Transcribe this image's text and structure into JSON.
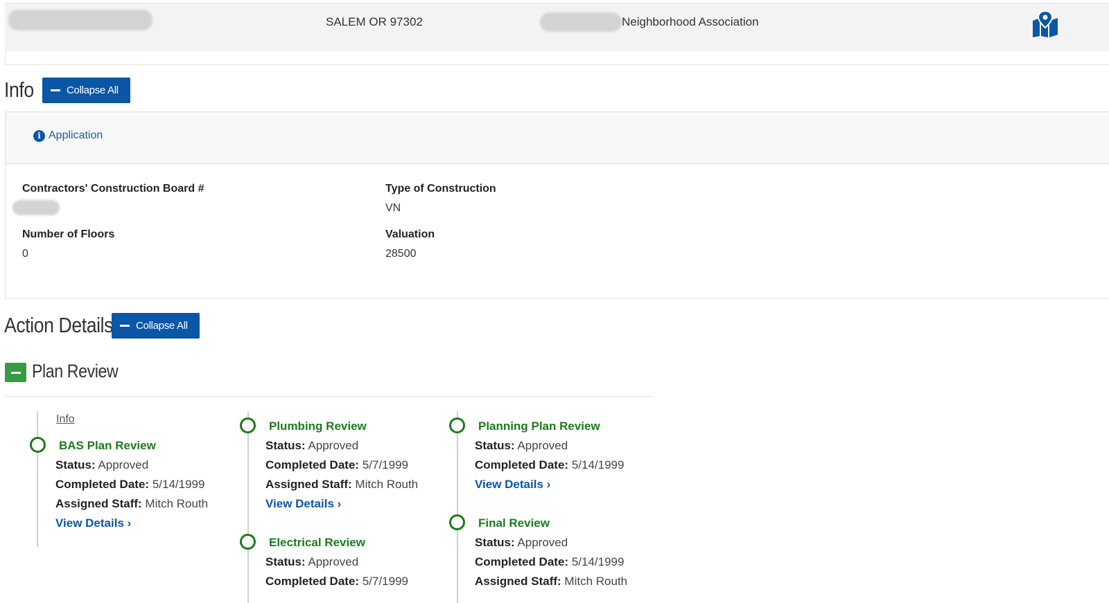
{
  "address_bar": {
    "city_state_zip": "SALEM OR 97302",
    "neighborhood_suffix": "Neighborhood Association"
  },
  "info_section": {
    "title": "Info",
    "collapse_label": "Collapse All",
    "tab_label": "Application",
    "fields": {
      "ccb_label": "Contractors' Construction Board #",
      "construction_type_label": "Type of Construction",
      "construction_type_value": "VN",
      "floors_label": "Number of Floors",
      "floors_value": "0",
      "valuation_label": "Valuation",
      "valuation_value": "28500"
    }
  },
  "action_details": {
    "title": "Action Details",
    "collapse_label": "Collapse All",
    "group_title": "Plan Review",
    "info_link": "Info",
    "status_label": "Status:",
    "completed_label": "Completed Date:",
    "staff_label": "Assigned Staff:",
    "view_details_label": "View Details ›",
    "reviews": [
      {
        "title": "BAS Plan Review",
        "status": "Approved",
        "completed": "5/14/1999",
        "staff": "Mitch Routh"
      },
      {
        "title": "Plumbing Review",
        "status": "Approved",
        "completed": "5/7/1999",
        "staff": "Mitch Routh"
      },
      {
        "title": "Electrical Review",
        "status": "Approved",
        "completed": "5/7/1999"
      },
      {
        "title": "Planning Plan Review",
        "status": "Approved",
        "completed": "5/14/1999"
      },
      {
        "title": "Final Review",
        "status": "Approved",
        "completed": "5/14/1999",
        "staff": "Mitch Routh"
      }
    ]
  },
  "colors": {
    "primary_blue": "#0b56a6",
    "review_green": "#1c7a1c",
    "toggle_green": "#3a9a43"
  }
}
